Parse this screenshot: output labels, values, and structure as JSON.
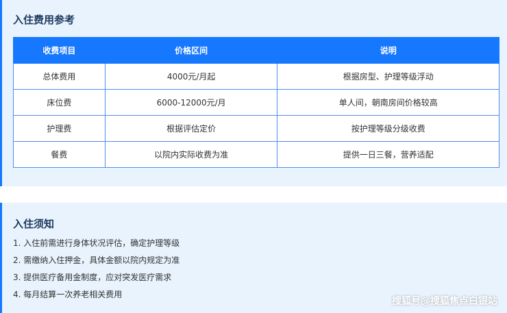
{
  "fees": {
    "title": "入住费用参考",
    "headers": [
      "收费项目",
      "价格区间",
      "说明"
    ],
    "rows": [
      [
        "总体费用",
        "4000元/月起",
        "根据房型、护理等级浮动"
      ],
      [
        "床位费",
        "6000-12000元/月",
        "单人间，朝南房间价格较高"
      ],
      [
        "护理费",
        "根据评估定价",
        "按护理等级分级收费"
      ],
      [
        "餐费",
        "以院内实际收费为准",
        "提供一日三餐，营养适配"
      ]
    ]
  },
  "notice": {
    "title": "入住须知",
    "items": [
      "1. 入住前需进行身体状况评估，确定护理等级",
      "2. 需缴纳入住押金，具体金额以院内规定为准",
      "3. 提供医疗备用金制度，应对突发医疗需求",
      "4. 每月结算一次养老相关费用"
    ]
  },
  "watermark": "搜狐号@搜狐焦点白银站",
  "colors": {
    "accent": "#1677ff",
    "section_bg": "#e8f3fd",
    "title": "#1e3a5f"
  }
}
